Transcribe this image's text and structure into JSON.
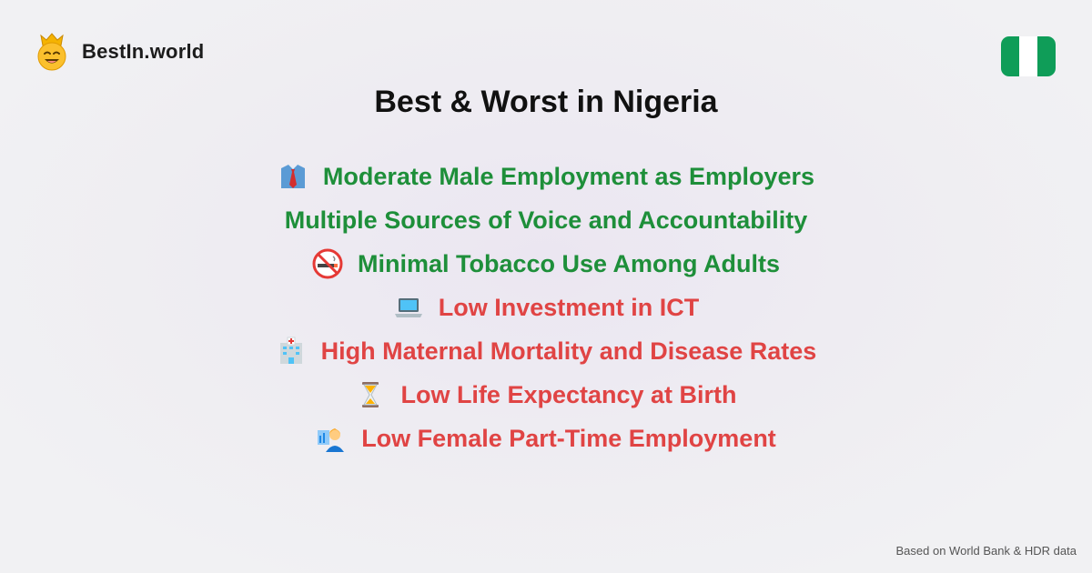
{
  "brand": {
    "name": "BestIn.world",
    "logo_icon": "crowned-smiley-icon"
  },
  "flag": {
    "country": "Nigeria",
    "colors": [
      "#0f9d58",
      "#ffffff",
      "#0f9d58"
    ]
  },
  "page": {
    "title": "Best & Worst in Nigeria"
  },
  "colors": {
    "good": "#1e8f3a",
    "bad": "#e04444"
  },
  "items": [
    {
      "label": "Moderate Male Employment as Employers",
      "kind": "good",
      "icon": "necktie-shirt-icon"
    },
    {
      "label": "Multiple Sources of Voice and Accountability",
      "kind": "good",
      "icon": ""
    },
    {
      "label": "Minimal Tobacco Use Among Adults",
      "kind": "good",
      "icon": "no-smoking-icon"
    },
    {
      "label": "Low Investment in ICT",
      "kind": "bad",
      "icon": "laptop-icon"
    },
    {
      "label": "High Maternal Mortality and Disease Rates",
      "kind": "bad",
      "icon": "hospital-icon"
    },
    {
      "label": "Low Life Expectancy at Birth",
      "kind": "bad",
      "icon": "hourglass-icon"
    },
    {
      "label": "Low Female Part-Time Employment",
      "kind": "bad",
      "icon": "woman-office-worker-icon"
    }
  ],
  "footer": {
    "note": "Based on World Bank & HDR data"
  }
}
